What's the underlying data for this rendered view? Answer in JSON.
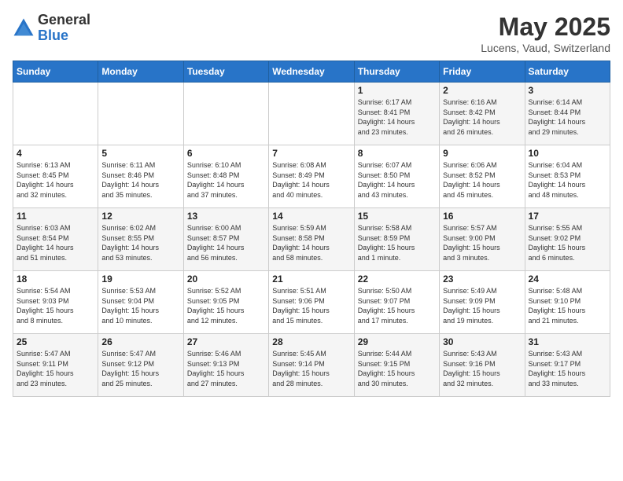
{
  "logo": {
    "general": "General",
    "blue": "Blue"
  },
  "title": "May 2025",
  "subtitle": "Lucens, Vaud, Switzerland",
  "weekdays": [
    "Sunday",
    "Monday",
    "Tuesday",
    "Wednesday",
    "Thursday",
    "Friday",
    "Saturday"
  ],
  "weeks": [
    [
      {
        "day": "",
        "info": ""
      },
      {
        "day": "",
        "info": ""
      },
      {
        "day": "",
        "info": ""
      },
      {
        "day": "",
        "info": ""
      },
      {
        "day": "1",
        "info": "Sunrise: 6:17 AM\nSunset: 8:41 PM\nDaylight: 14 hours\nand 23 minutes."
      },
      {
        "day": "2",
        "info": "Sunrise: 6:16 AM\nSunset: 8:42 PM\nDaylight: 14 hours\nand 26 minutes."
      },
      {
        "day": "3",
        "info": "Sunrise: 6:14 AM\nSunset: 8:44 PM\nDaylight: 14 hours\nand 29 minutes."
      }
    ],
    [
      {
        "day": "4",
        "info": "Sunrise: 6:13 AM\nSunset: 8:45 PM\nDaylight: 14 hours\nand 32 minutes."
      },
      {
        "day": "5",
        "info": "Sunrise: 6:11 AM\nSunset: 8:46 PM\nDaylight: 14 hours\nand 35 minutes."
      },
      {
        "day": "6",
        "info": "Sunrise: 6:10 AM\nSunset: 8:48 PM\nDaylight: 14 hours\nand 37 minutes."
      },
      {
        "day": "7",
        "info": "Sunrise: 6:08 AM\nSunset: 8:49 PM\nDaylight: 14 hours\nand 40 minutes."
      },
      {
        "day": "8",
        "info": "Sunrise: 6:07 AM\nSunset: 8:50 PM\nDaylight: 14 hours\nand 43 minutes."
      },
      {
        "day": "9",
        "info": "Sunrise: 6:06 AM\nSunset: 8:52 PM\nDaylight: 14 hours\nand 45 minutes."
      },
      {
        "day": "10",
        "info": "Sunrise: 6:04 AM\nSunset: 8:53 PM\nDaylight: 14 hours\nand 48 minutes."
      }
    ],
    [
      {
        "day": "11",
        "info": "Sunrise: 6:03 AM\nSunset: 8:54 PM\nDaylight: 14 hours\nand 51 minutes."
      },
      {
        "day": "12",
        "info": "Sunrise: 6:02 AM\nSunset: 8:55 PM\nDaylight: 14 hours\nand 53 minutes."
      },
      {
        "day": "13",
        "info": "Sunrise: 6:00 AM\nSunset: 8:57 PM\nDaylight: 14 hours\nand 56 minutes."
      },
      {
        "day": "14",
        "info": "Sunrise: 5:59 AM\nSunset: 8:58 PM\nDaylight: 14 hours\nand 58 minutes."
      },
      {
        "day": "15",
        "info": "Sunrise: 5:58 AM\nSunset: 8:59 PM\nDaylight: 15 hours\nand 1 minute."
      },
      {
        "day": "16",
        "info": "Sunrise: 5:57 AM\nSunset: 9:00 PM\nDaylight: 15 hours\nand 3 minutes."
      },
      {
        "day": "17",
        "info": "Sunrise: 5:55 AM\nSunset: 9:02 PM\nDaylight: 15 hours\nand 6 minutes."
      }
    ],
    [
      {
        "day": "18",
        "info": "Sunrise: 5:54 AM\nSunset: 9:03 PM\nDaylight: 15 hours\nand 8 minutes."
      },
      {
        "day": "19",
        "info": "Sunrise: 5:53 AM\nSunset: 9:04 PM\nDaylight: 15 hours\nand 10 minutes."
      },
      {
        "day": "20",
        "info": "Sunrise: 5:52 AM\nSunset: 9:05 PM\nDaylight: 15 hours\nand 12 minutes."
      },
      {
        "day": "21",
        "info": "Sunrise: 5:51 AM\nSunset: 9:06 PM\nDaylight: 15 hours\nand 15 minutes."
      },
      {
        "day": "22",
        "info": "Sunrise: 5:50 AM\nSunset: 9:07 PM\nDaylight: 15 hours\nand 17 minutes."
      },
      {
        "day": "23",
        "info": "Sunrise: 5:49 AM\nSunset: 9:09 PM\nDaylight: 15 hours\nand 19 minutes."
      },
      {
        "day": "24",
        "info": "Sunrise: 5:48 AM\nSunset: 9:10 PM\nDaylight: 15 hours\nand 21 minutes."
      }
    ],
    [
      {
        "day": "25",
        "info": "Sunrise: 5:47 AM\nSunset: 9:11 PM\nDaylight: 15 hours\nand 23 minutes."
      },
      {
        "day": "26",
        "info": "Sunrise: 5:47 AM\nSunset: 9:12 PM\nDaylight: 15 hours\nand 25 minutes."
      },
      {
        "day": "27",
        "info": "Sunrise: 5:46 AM\nSunset: 9:13 PM\nDaylight: 15 hours\nand 27 minutes."
      },
      {
        "day": "28",
        "info": "Sunrise: 5:45 AM\nSunset: 9:14 PM\nDaylight: 15 hours\nand 28 minutes."
      },
      {
        "day": "29",
        "info": "Sunrise: 5:44 AM\nSunset: 9:15 PM\nDaylight: 15 hours\nand 30 minutes."
      },
      {
        "day": "30",
        "info": "Sunrise: 5:43 AM\nSunset: 9:16 PM\nDaylight: 15 hours\nand 32 minutes."
      },
      {
        "day": "31",
        "info": "Sunrise: 5:43 AM\nSunset: 9:17 PM\nDaylight: 15 hours\nand 33 minutes."
      }
    ]
  ]
}
